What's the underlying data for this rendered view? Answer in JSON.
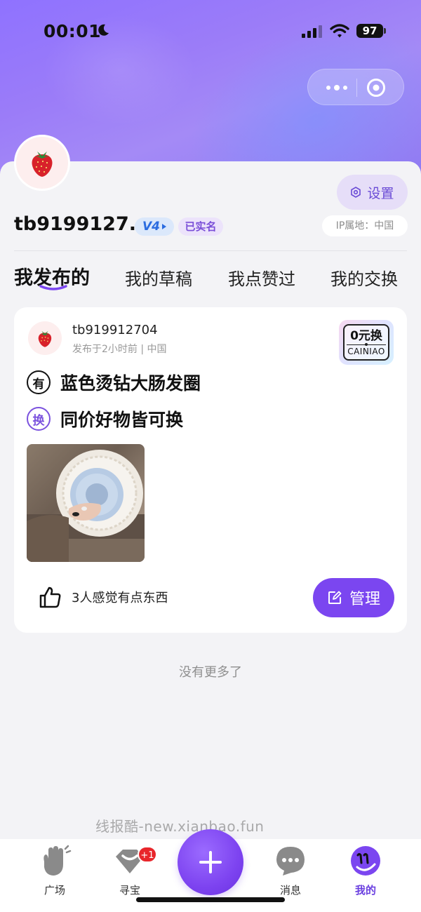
{
  "status_bar": {
    "time": "00:01",
    "battery": "97"
  },
  "profile": {
    "username": "tb9199127...",
    "level_badge": "V4",
    "verified_badge": "已实名",
    "settings_label": "设置",
    "ip_location": "IP属地：中国"
  },
  "tabs": [
    {
      "label": "我发布的",
      "active": true
    },
    {
      "label": "我的草稿",
      "active": false
    },
    {
      "label": "我点赞过",
      "active": false
    },
    {
      "label": "我的交换",
      "active": false
    }
  ],
  "post": {
    "user": "tb919912704",
    "meta": "发布于2小时前 | 中国",
    "badge_top": "0元换",
    "badge_bottom": "CAINIAO",
    "have_icon": "有",
    "have_text": "蓝色烫钻大肠发圈",
    "exchange_icon": "换",
    "exchange_text": "同价好物皆可换",
    "likes_text": "3人感觉有点东西",
    "manage_label": "管理"
  },
  "footer_text": "没有更多了",
  "watermark": "线报酷-new.xianbao.fun",
  "tabbar": {
    "items": [
      {
        "label": "广场",
        "icon": "hand-wave-icon"
      },
      {
        "label": "寻宝",
        "icon": "treasure-icon",
        "badge": "+1"
      },
      {
        "label": "",
        "icon": "plus-icon"
      },
      {
        "label": "消息",
        "icon": "message-icon"
      },
      {
        "label": "我的",
        "icon": "profile-icon",
        "active": true
      }
    ]
  },
  "colors": {
    "accent": "#7b46f0",
    "header_gradient_start": "#8f72ff",
    "badge_red": "#e8262b"
  }
}
